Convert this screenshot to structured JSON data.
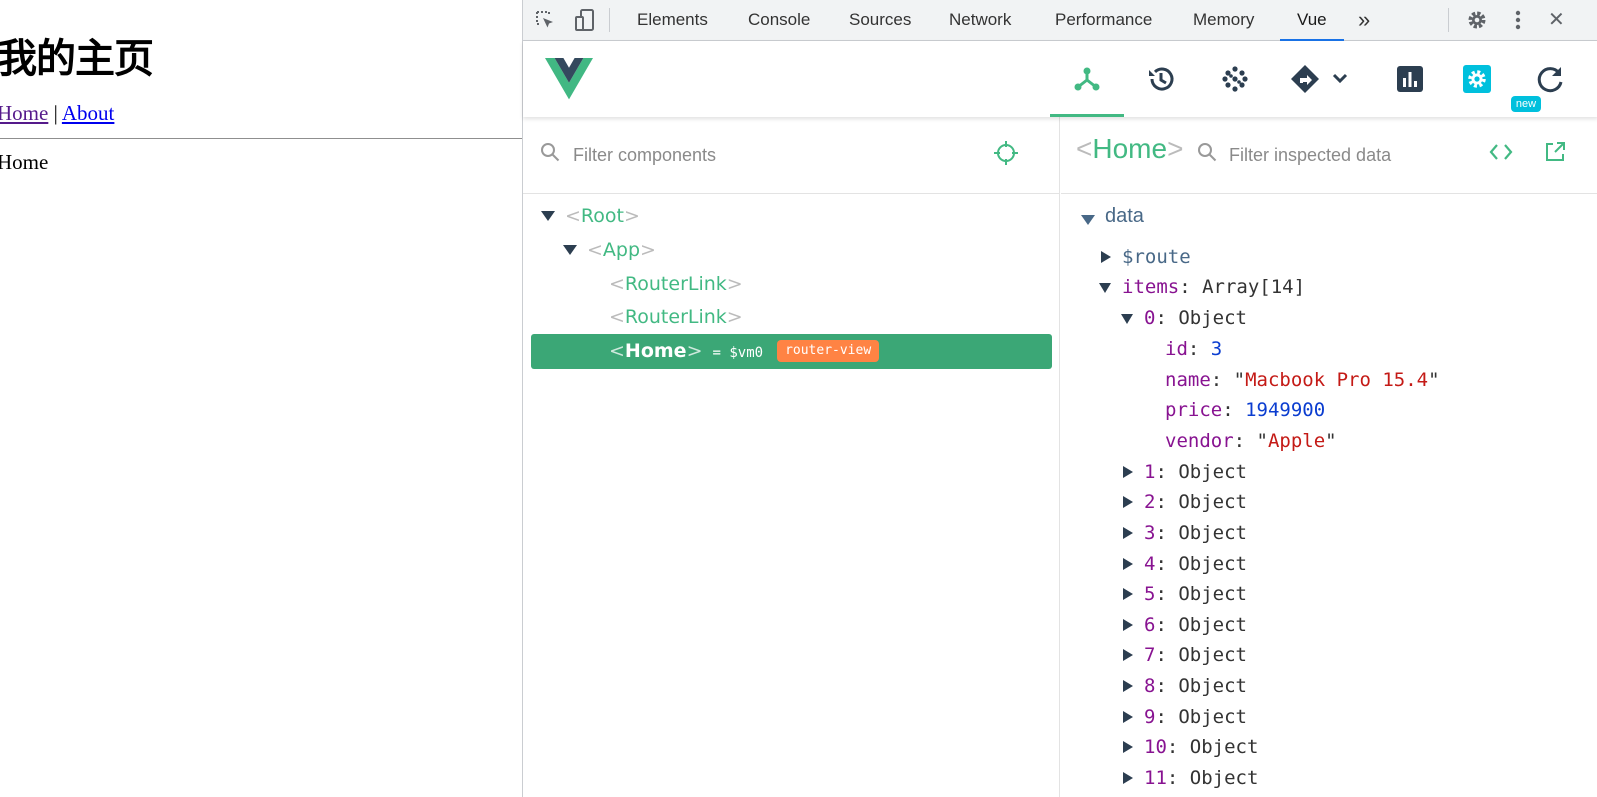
{
  "page": {
    "heading": "我的主页",
    "nav": {
      "home": "Home",
      "sep": "|",
      "about": "About"
    },
    "view_text": "Home"
  },
  "devtools": {
    "tabs": [
      "Elements",
      "Console",
      "Sources",
      "Network",
      "Performance",
      "Memory",
      "Vue"
    ],
    "active_tab": "Vue",
    "overflow": "»",
    "close": "✕",
    "colors": {
      "vue_green": "#42b983",
      "tab_active": "#1a73e8",
      "selected_row": "#3ba776",
      "badge_orange": "#ff8344",
      "badge_new": "#00c0dd"
    }
  },
  "vue": {
    "toolbar": {
      "new_badge": "new"
    },
    "components": {
      "filter_placeholder": "Filter components",
      "tree": [
        {
          "name": "Root",
          "level": 0,
          "expanded": true
        },
        {
          "name": "App",
          "level": 1,
          "expanded": true
        },
        {
          "name": "RouterLink",
          "level": 2
        },
        {
          "name": "RouterLink",
          "level": 2
        },
        {
          "name": "Home",
          "level": 2,
          "selected": true,
          "vm": "= $vm0",
          "badge": "router-view"
        }
      ]
    },
    "inspector": {
      "component": "Home",
      "filter_placeholder": "Filter inspected data",
      "section": "data",
      "route_key": "$route",
      "items_key": "items",
      "items_type": "Array[14]",
      "item0": {
        "key": "0",
        "type": "Object",
        "id_key": "id",
        "id_val": "3",
        "name_key": "name",
        "name_val": "Macbook Pro 15.4",
        "price_key": "price",
        "price_val": "1949900",
        "vendor_key": "vendor",
        "vendor_val": "Apple"
      },
      "collapsed_items": [
        {
          "key": "1",
          "type": "Object"
        },
        {
          "key": "2",
          "type": "Object"
        },
        {
          "key": "3",
          "type": "Object"
        },
        {
          "key": "4",
          "type": "Object"
        },
        {
          "key": "5",
          "type": "Object"
        },
        {
          "key": "6",
          "type": "Object"
        },
        {
          "key": "7",
          "type": "Object"
        },
        {
          "key": "8",
          "type": "Object"
        },
        {
          "key": "9",
          "type": "Object"
        },
        {
          "key": "10",
          "type": "Object"
        },
        {
          "key": "11",
          "type": "Object"
        }
      ]
    }
  }
}
